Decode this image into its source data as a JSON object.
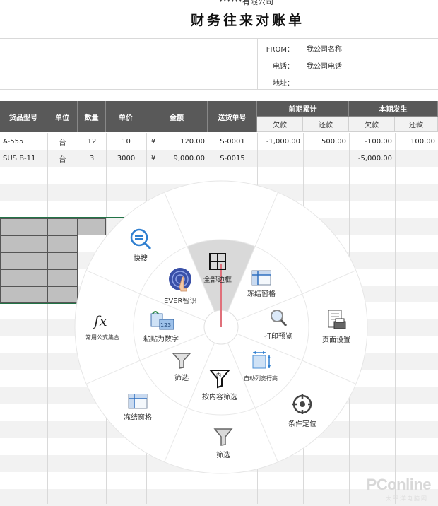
{
  "sheet": {
    "company": "******有限公司",
    "title": "财务往来对账单",
    "info": {
      "from_label": "FROM：",
      "from_value": "我公司名称",
      "phone_label": "电话：",
      "phone_value": "我公司电话",
      "addr_label": "地址：",
      "addr_value": ""
    },
    "headers": {
      "model": "货品型号",
      "unit": "单位",
      "qty": "数量",
      "price": "单价",
      "amount": "金额",
      "delivery_no": "送货单号",
      "prev_group": "前期累计",
      "curr_group": "本期发生",
      "prev_debt": "欠款",
      "prev_paid": "还款",
      "curr_debt": "欠款",
      "curr_paid": "还款"
    },
    "rows": [
      {
        "model": "A-555",
        "unit": "台",
        "qty": "12",
        "price": "10",
        "currency": "¥",
        "amount": "120.00",
        "delivery_no": "S-0001",
        "prev_debt": "-1,000.00",
        "prev_paid": "500.00",
        "curr_debt": "-100.00",
        "curr_paid": "100.00"
      },
      {
        "model": "SUS B-11",
        "unit": "台",
        "qty": "3",
        "price": "3000",
        "currency": "¥",
        "amount": "9,000.00",
        "delivery_no": "S-0015",
        "prev_debt": "",
        "prev_paid": "",
        "curr_debt": "-5,000.00",
        "curr_paid": ""
      }
    ]
  },
  "radial_menu": {
    "inner": {
      "full_border": "全部边框",
      "freeze_panes": "冻结窗格",
      "print_preview": "打印预览",
      "auto_row_height": "自动列宽行高",
      "filter_by_content": "按内容筛选",
      "filter": "筛选",
      "paste_as_number": "粘贴为数字",
      "ever_smart": "EVER智识"
    },
    "outer": {
      "quick_search": "快搜",
      "page_setup": "页面设置",
      "condition_locate": "条件定位",
      "filter": "筛选",
      "freeze_panes": "冻结窗格",
      "formula_set": "常用公式集合"
    },
    "colors": {
      "wheel": "#ffffff",
      "active_sector": "#d9d9d9",
      "pointer": "#e0707a"
    }
  },
  "watermark": {
    "brand": "PConline",
    "sub": "太平洋电脑网"
  }
}
